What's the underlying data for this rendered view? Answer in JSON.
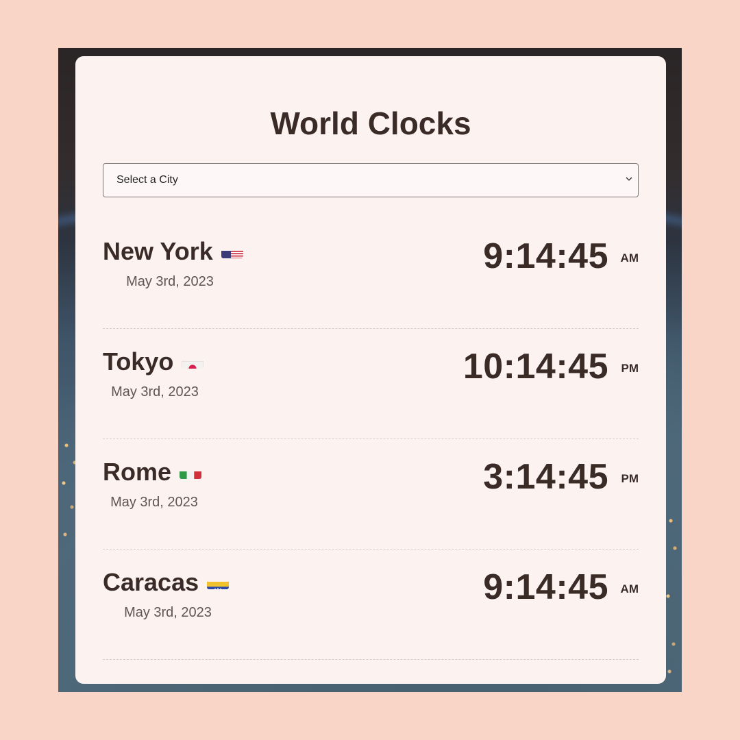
{
  "title": "World Clocks",
  "select": {
    "placeholder": "Select a City"
  },
  "clocks": [
    {
      "city": "New York",
      "flag": "flag-us-icon",
      "date": "May 3rd, 2023",
      "time": "9:14:45",
      "period": "AM"
    },
    {
      "city": "Tokyo",
      "flag": "flag-jp-icon",
      "date": "May 3rd, 2023",
      "time": "10:14:45",
      "period": "PM"
    },
    {
      "city": "Rome",
      "flag": "flag-it-icon",
      "date": "May 3rd, 2023",
      "time": "3:14:45",
      "period": "PM"
    },
    {
      "city": "Caracas",
      "flag": "flag-ve-icon",
      "date": "May 3rd, 2023",
      "time": "9:14:45",
      "period": "AM"
    }
  ],
  "colors": {
    "page_background": "#f8d5c6",
    "card_background": "#fcf3f1",
    "text": "#3a2b27"
  }
}
